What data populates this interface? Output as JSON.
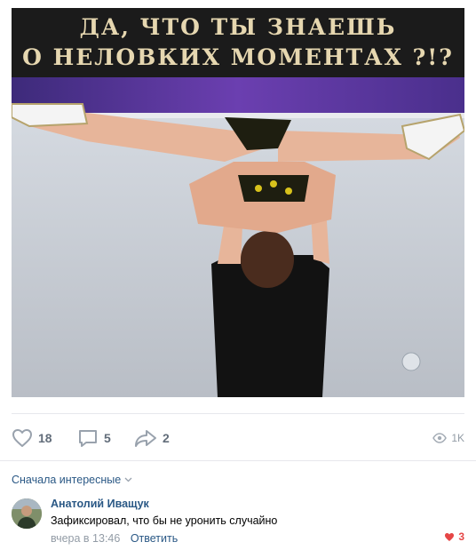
{
  "post": {
    "image_caption_line1": "ДА, ЧТО ТЫ ЗНАЕШЬ",
    "image_caption_line2": "О НЕЛОВКИХ МОМЕНТАХ ?!?"
  },
  "actions": {
    "likes": "18",
    "comments": "5",
    "shares": "2",
    "views": "1K"
  },
  "comments_section": {
    "sort_label": "Сначала интересные",
    "items": [
      {
        "author": "Анатолий Иващук",
        "text": "Зафиксировал, что бы не уронить случайно",
        "time": "вчера в 13:46",
        "reply_label": "Ответить",
        "likes": "3"
      }
    ]
  },
  "colors": {
    "link": "#2a5885",
    "muted": "#939ca6",
    "icon": "#99a2ad",
    "like_active": "#e64646",
    "banner_text": "#e6d7b0"
  }
}
